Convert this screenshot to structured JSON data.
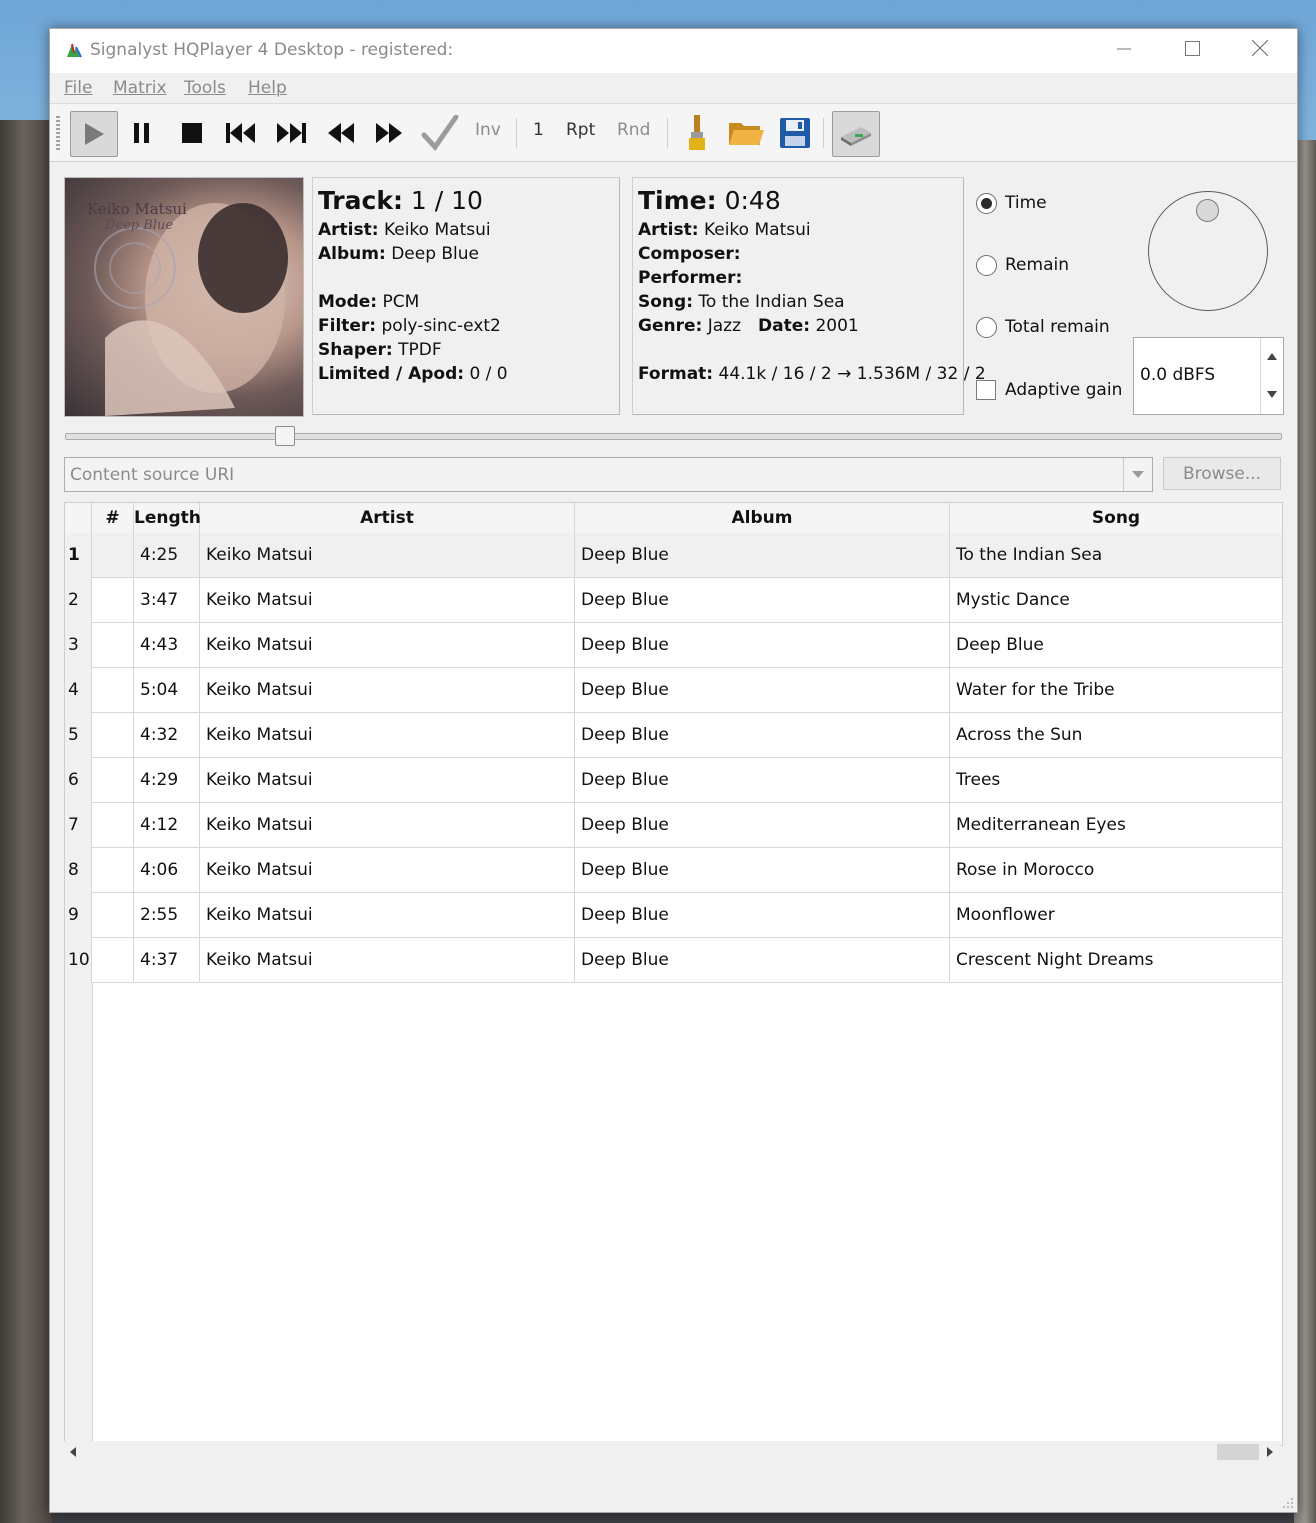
{
  "window": {
    "title": "Signalyst HQPlayer 4 Desktop - registered:"
  },
  "menu": [
    "File",
    "Matrix",
    "Tools",
    "Help"
  ],
  "toolbar": {
    "inv": "Inv",
    "count": "1",
    "rpt": "Rpt",
    "rnd": "Rnd"
  },
  "track_info": {
    "track_label": "Track:",
    "track_value": "1 / 10",
    "artist_label": "Artist:",
    "artist": "Keiko Matsui",
    "album_label": "Album:",
    "album": "Deep Blue",
    "mode_label": "Mode:",
    "mode": "PCM",
    "filter_label": "Filter:",
    "filter": "poly-sinc-ext2",
    "shaper_label": "Shaper:",
    "shaper": "TPDF",
    "limited_label": "Limited / Apod:",
    "limited": "0 / 0"
  },
  "album_art": {
    "artist_text": "Keiko Matsui",
    "album_text": "Deep Blue"
  },
  "time_info": {
    "time_label": "Time:",
    "time_value": "0:48",
    "artist_label": "Artist:",
    "artist": "Keiko Matsui",
    "composer_label": "Composer:",
    "performer_label": "Performer:",
    "song_label": "Song:",
    "song": "To the Indian Sea",
    "genre_label": "Genre:",
    "genre": "Jazz",
    "date_label": "Date:",
    "date": "2001",
    "format_label": "Format:",
    "format": "44.1k / 16 / 2 → 1.536M / 32 / 2"
  },
  "display_mode": {
    "options": [
      "Time",
      "Remain",
      "Total remain"
    ],
    "selected": "Time",
    "adaptive_gain_label": "Adaptive gain",
    "adaptive_gain_checked": false
  },
  "volume": {
    "value": "0.0 dBFS"
  },
  "seek": {
    "position_fraction": 0.18
  },
  "source": {
    "placeholder": "Content source URI",
    "browse_label": "Browse..."
  },
  "table": {
    "headers": [
      "#",
      "Length",
      "Artist",
      "Album",
      "Song"
    ],
    "current_row": 1,
    "rows": [
      {
        "n": "1",
        "length": "4:25",
        "artist": "Keiko Matsui",
        "album": "Deep Blue",
        "song": "To the Indian Sea"
      },
      {
        "n": "2",
        "length": "3:47",
        "artist": "Keiko Matsui",
        "album": "Deep Blue",
        "song": "Mystic Dance"
      },
      {
        "n": "3",
        "length": "4:43",
        "artist": "Keiko Matsui",
        "album": "Deep Blue",
        "song": "Deep Blue"
      },
      {
        "n": "4",
        "length": "5:04",
        "artist": "Keiko Matsui",
        "album": "Deep Blue",
        "song": "Water for the Tribe"
      },
      {
        "n": "5",
        "length": "4:32",
        "artist": "Keiko Matsui",
        "album": "Deep Blue",
        "song": "Across the Sun"
      },
      {
        "n": "6",
        "length": "4:29",
        "artist": "Keiko Matsui",
        "album": "Deep Blue",
        "song": "Trees"
      },
      {
        "n": "7",
        "length": "4:12",
        "artist": "Keiko Matsui",
        "album": "Deep Blue",
        "song": "Mediterranean Eyes"
      },
      {
        "n": "8",
        "length": "4:06",
        "artist": "Keiko Matsui",
        "album": "Deep Blue",
        "song": "Rose in Morocco"
      },
      {
        "n": "9",
        "length": "2:55",
        "artist": "Keiko Matsui",
        "album": "Deep Blue",
        "song": "Moonflower"
      },
      {
        "n": "10",
        "length": "4:37",
        "artist": "Keiko Matsui",
        "album": "Deep Blue",
        "song": "Crescent Night Dreams"
      }
    ]
  }
}
